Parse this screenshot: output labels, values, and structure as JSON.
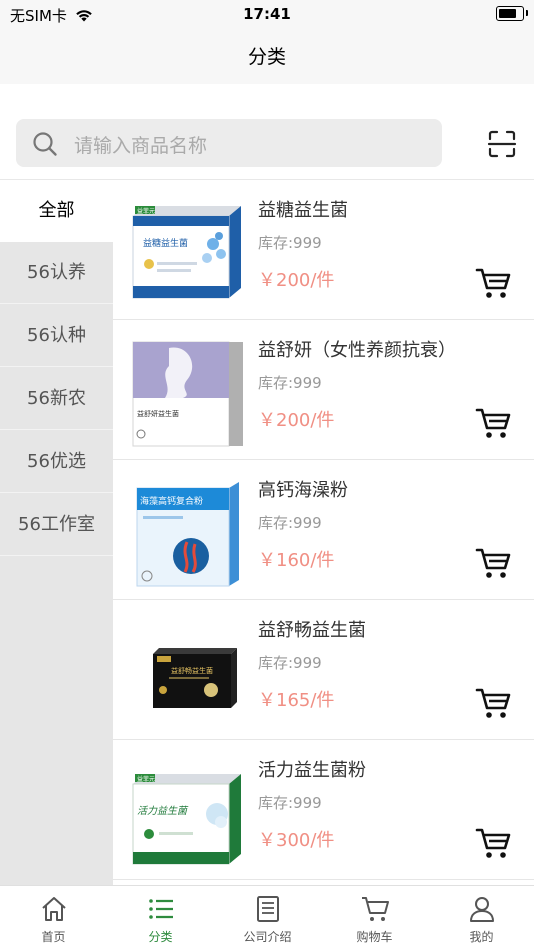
{
  "status_bar": {
    "carrier": "无SIM卡",
    "time": "17:41",
    "battery_level": 0.8
  },
  "header": {
    "title": "分类"
  },
  "search": {
    "placeholder": "请输入商品名称"
  },
  "sidebar": {
    "items": [
      {
        "label": "全部",
        "active": true
      },
      {
        "label": "56认养"
      },
      {
        "label": "56认种"
      },
      {
        "label": "56新农"
      },
      {
        "label": "56优选"
      },
      {
        "label": "56工作室"
      }
    ]
  },
  "products": [
    {
      "name": "益糖益生菌",
      "stock": "库存:999",
      "price": "￥200/件",
      "box_text": "益糖益生菌",
      "box_brand": "益菲元"
    },
    {
      "name": "益舒妍（女性养颜抗衰）",
      "stock": "库存:999",
      "price": "￥200/件",
      "box_text": "益舒妍益生菌"
    },
    {
      "name": "高钙海澡粉",
      "stock": "库存:999",
      "price": "￥160/件",
      "box_text": "海藻高钙复合粉"
    },
    {
      "name": "益舒畅益生菌",
      "stock": "库存:999",
      "price": "￥165/件",
      "box_text": "益舒畅益生菌"
    },
    {
      "name": "活力益生菌粉",
      "stock": "库存:999",
      "price": "￥300/件",
      "box_text": "活力益生菌",
      "box_brand": "益菲元"
    }
  ],
  "tab_bar": {
    "items": [
      {
        "label": "首页",
        "icon": "home-icon"
      },
      {
        "label": "分类",
        "icon": "list-icon",
        "active": true
      },
      {
        "label": "公司介绍",
        "icon": "document-icon"
      },
      {
        "label": "购物车",
        "icon": "cart-icon"
      },
      {
        "label": "我的",
        "icon": "user-icon"
      }
    ]
  },
  "colors": {
    "price": "#f08f84",
    "active_tab": "#2e8b3e",
    "sidebar_bg": "#e6e6e6"
  }
}
